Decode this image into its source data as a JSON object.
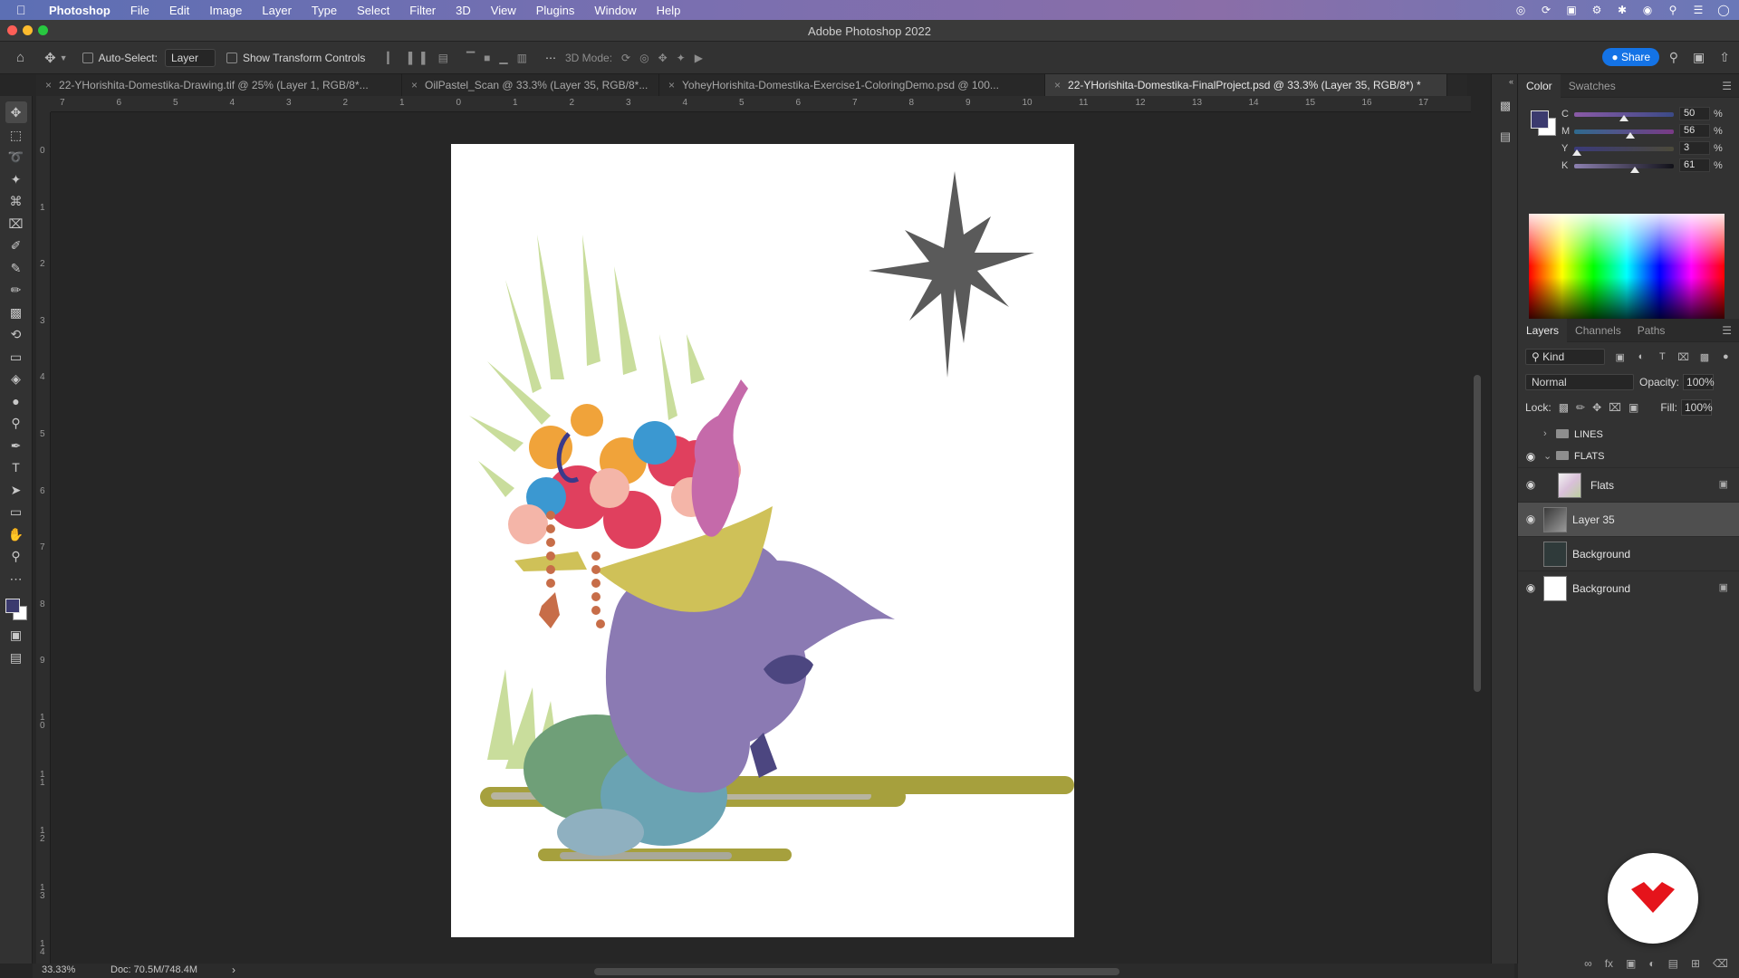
{
  "menubar": {
    "app": "Photoshop",
    "items": [
      "File",
      "Edit",
      "Image",
      "Layer",
      "Type",
      "Select",
      "Filter",
      "3D",
      "View",
      "Plugins",
      "Window",
      "Help"
    ]
  },
  "window": {
    "title": "Adobe Photoshop 2022"
  },
  "options": {
    "auto_select_label": "Auto-Select:",
    "auto_select_value": "Layer",
    "transform_label": "Show Transform Controls",
    "mode_3d_label": "3D Mode:",
    "share_label": "Share"
  },
  "tabs": [
    {
      "label": "22-YHorishita-Domestika-Drawing.tif @ 25% (Layer 1, RGB/8*..."
    },
    {
      "label": "OilPastel_Scan @ 33.3% (Layer 35, RGB/8*..."
    },
    {
      "label": "YoheyHorishita-Domestika-Exercise1-ColoringDemo.psd @ 100..."
    },
    {
      "label": "22-YHorishita-Domestika-FinalProject.psd @ 33.3% (Layer 35, RGB/8*) *"
    }
  ],
  "ruler_h": [
    "7",
    "6",
    "5",
    "4",
    "3",
    "2",
    "1",
    "0",
    "1",
    "2",
    "3",
    "4",
    "5",
    "6",
    "7",
    "8",
    "9",
    "10",
    "11",
    "12",
    "13",
    "14",
    "15",
    "16",
    "17"
  ],
  "ruler_v": [
    "0",
    "1",
    "2",
    "3",
    "4",
    "5",
    "6",
    "7",
    "8",
    "9",
    "1\n0",
    "1\n1",
    "1\n2",
    "1\n3",
    "1\n4"
  ],
  "status": {
    "zoom": "33.33%",
    "doc": "Doc: 70.5M/748.4M"
  },
  "color_panel": {
    "tabs": [
      "Color",
      "Swatches"
    ],
    "cmyk": [
      {
        "label": "C",
        "value": "50"
      },
      {
        "label": "M",
        "value": "56"
      },
      {
        "label": "Y",
        "value": "3"
      },
      {
        "label": "K",
        "value": "61"
      }
    ],
    "percent": "%"
  },
  "layers_panel": {
    "tabs": [
      "Layers",
      "Channels",
      "Paths"
    ],
    "kind": "Kind",
    "blend_mode": "Normal",
    "opacity_label": "Opacity:",
    "opacity": "100%",
    "lock_label": "Lock:",
    "fill_label": "Fill:",
    "fill": "100%",
    "groups": [
      {
        "name": "LINES",
        "visible": false,
        "expanded": false
      },
      {
        "name": "FLATS",
        "visible": true,
        "expanded": true
      }
    ],
    "layers": [
      {
        "name": "Flats",
        "visible": true,
        "locked": true,
        "selected": false
      },
      {
        "name": "Layer 35",
        "visible": true,
        "locked": false,
        "selected": true
      },
      {
        "name": "Background",
        "visible": false,
        "locked": false,
        "selected": false
      },
      {
        "name": "Background",
        "visible": true,
        "locked": true,
        "selected": false
      }
    ]
  },
  "colors": {
    "foreground": "#3b3a6e",
    "background": "#ffffff",
    "accent": "#1473e6",
    "domestika_red": "#e5141b"
  }
}
